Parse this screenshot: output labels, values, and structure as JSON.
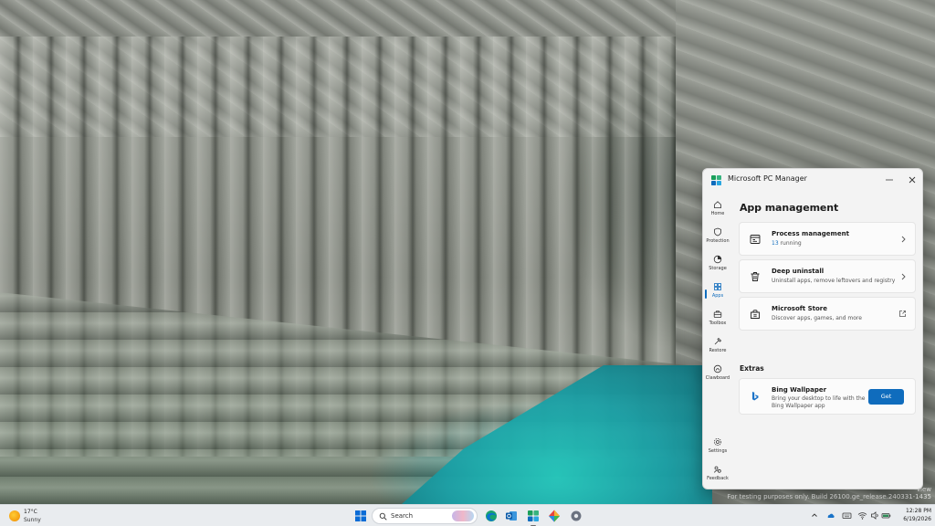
{
  "desktop": {
    "watermark_lines": [
      "view",
      "For testing purposes only. Build 26100.ge_release.240331-1435"
    ]
  },
  "window": {
    "title": "Microsoft PC Manager",
    "minimize_icon": "minimize-icon",
    "close_icon": "close-icon",
    "nav": [
      {
        "label": "Home",
        "icon": "home-icon"
      },
      {
        "label": "Protection",
        "icon": "shield-icon"
      },
      {
        "label": "Storage",
        "icon": "storage-icon"
      },
      {
        "label": "Apps",
        "icon": "apps-icon",
        "active": true
      },
      {
        "label": "Toolbox",
        "icon": "toolbox-icon"
      },
      {
        "label": "Restore",
        "icon": "restore-icon"
      },
      {
        "label": "Clawboard",
        "icon": "clipboard-icon"
      },
      {
        "label": "Settings",
        "icon": "gear-icon"
      },
      {
        "label": "Feedback",
        "icon": "feedback-icon"
      }
    ],
    "page_title": "App management",
    "cards": [
      {
        "title": "Process management",
        "count": "13",
        "subtitle_suffix": " running",
        "icon": "process-icon"
      },
      {
        "title": "Deep uninstall",
        "subtitle": "Uninstall apps, remove leftovers and registry",
        "icon": "trash-icon"
      },
      {
        "title": "Microsoft Store",
        "subtitle": "Discover apps, games, and more",
        "icon": "store-icon"
      }
    ],
    "extras_label": "Extras",
    "extras": [
      {
        "title": "Bing Wallpaper",
        "subtitle_lines": [
          "Bring your desktop to life with the",
          "Bing Wallpaper app"
        ],
        "button_label": "Get",
        "icon": "bing-icon"
      }
    ],
    "accent_color": "#0f6cbd"
  },
  "taskbar": {
    "weather": {
      "temp": "17°C",
      "condition": "Sunny"
    },
    "search_placeholder": "Search",
    "pinned": [
      "start-icon",
      "copilot-icon",
      "edge-icon",
      "outlook-icon",
      "pc-manager-icon",
      "photos-icon",
      "settings-icon"
    ],
    "clock": {
      "time": "12:28 PM",
      "date": "6/19/2026"
    }
  }
}
